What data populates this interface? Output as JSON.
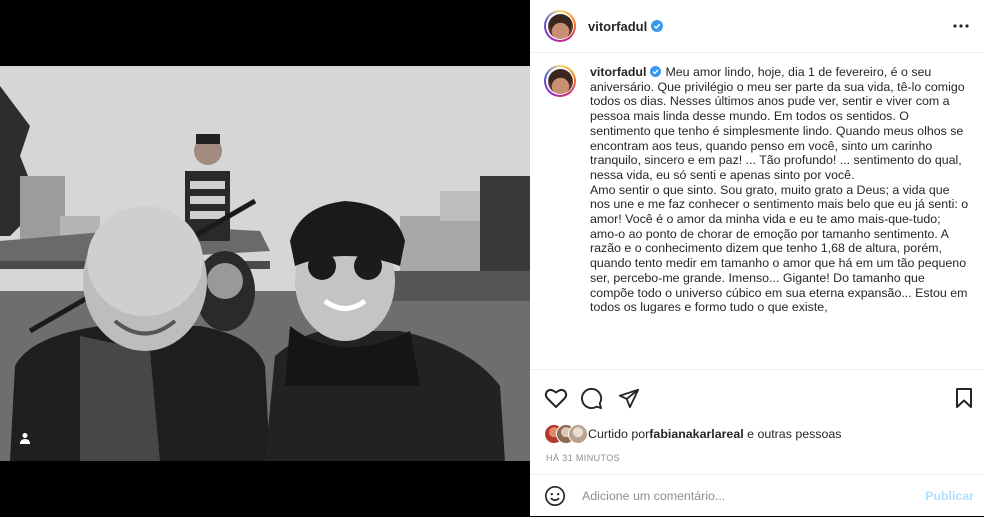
{
  "post": {
    "username": "vitorfadul",
    "caption_paragraph_1": "Meu amor lindo, hoje, dia 1 de fevereiro, é o seu aniversário. Que privilégio o meu ser parte da sua vida, tê-lo comigo todos os dias. Nesses últimos anos pude ver, sentir e viver com a pessoa mais linda desse mundo. Em todos os sentidos. O sentimento que tenho é simplesmente lindo. Quando meus olhos se encontram aos teus, quando penso em você, sinto um carinho tranquilo, sincero e em paz! ... Tão profundo! ... sentimento do qual, nessa vida, eu só senti e apenas sinto por você.",
    "caption_paragraph_2": "Amo sentir o que sinto. Sou grato, muito grato a Deus; a vida que nos une e me faz conhecer o sentimento mais belo que eu já senti: o amor! Você é o amor da minha vida e eu te amo mais-que-tudo; amo-o ao ponto de chorar de emoção por tamanho sentimento. A razão e o conhecimento dizem que tenho 1,68 de altura, porém, quando tento medir em tamanho o amor que há em um tão pequeno ser, percebo-me grande. Imenso... Gigante! Do tamanho que compõe todo o universo cúbico em sua eterna expansão... Estou em todos os lugares e formo tudo o que existe,",
    "liked_by_prefix": "Curtido por ",
    "liked_by_user": "fabianakarlareal",
    "liked_by_suffix": " e outras pessoas",
    "timestamp": "HÁ 31 MINUTOS"
  },
  "comment": {
    "placeholder": "Adicione um comentário...",
    "publish_label": "Publicar"
  },
  "colors": {
    "verified": "#3897f0",
    "publish_disabled": "#b2dffc",
    "secondary_text": "#8e8e8e"
  },
  "icons": [
    "verified-badge-icon",
    "more-options-icon",
    "heart-icon",
    "comment-icon",
    "share-icon",
    "bookmark-icon",
    "emoji-icon",
    "user-tag-icon"
  ]
}
